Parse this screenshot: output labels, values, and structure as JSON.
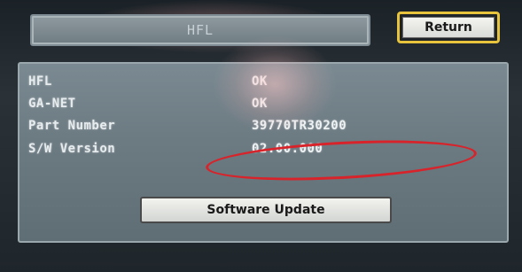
{
  "header": {
    "title": "HFL",
    "return_label": "Return"
  },
  "info": {
    "rows": [
      {
        "label": "HFL",
        "value": "OK"
      },
      {
        "label": "GA-NET",
        "value": "OK"
      },
      {
        "label": "Part Number",
        "value": "39770TR30200"
      },
      {
        "label": "S/W Version",
        "value": "02.00.000"
      }
    ]
  },
  "actions": {
    "software_update_label": "Software Update"
  },
  "colors": {
    "highlight": "#d8232a",
    "return_border": "#e8c43c"
  }
}
